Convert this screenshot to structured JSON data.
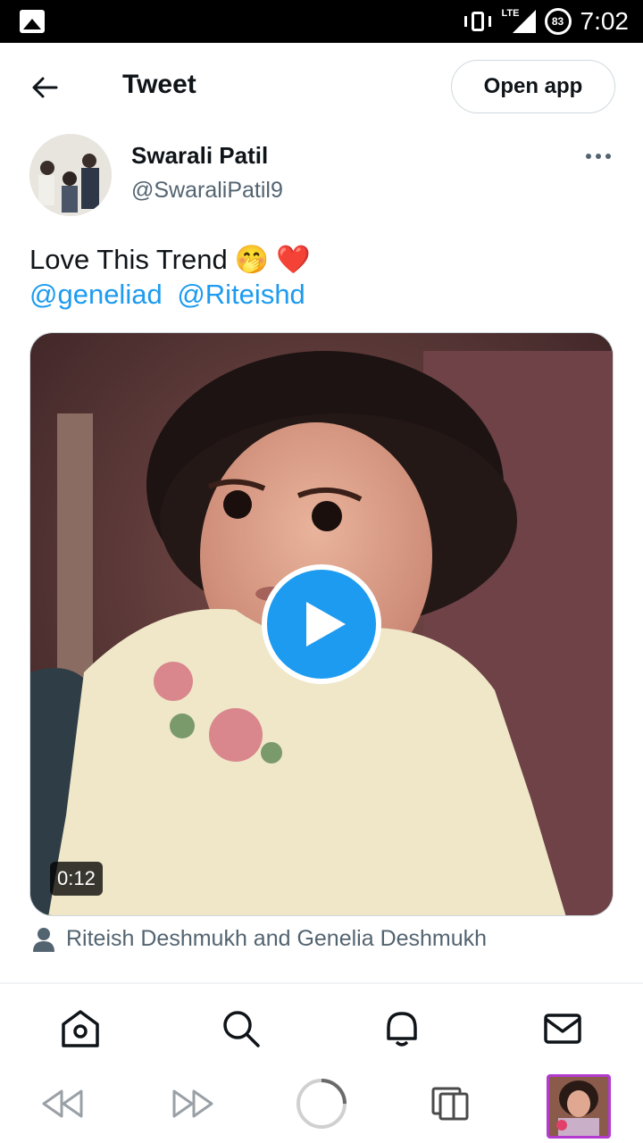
{
  "status_bar": {
    "network": "LTE",
    "battery": "83",
    "time": "7:02",
    "icons": [
      "gallery-icon",
      "vibrate-icon",
      "signal-icon",
      "battery-icon"
    ]
  },
  "header": {
    "title": "Tweet",
    "open_app_label": "Open app"
  },
  "tweet": {
    "author_name": "Swarali Patil",
    "author_handle": "@SwaraliPatil9",
    "text": "Love This Trend",
    "emojis": [
      "🤭",
      "❤️"
    ],
    "mentions": [
      "@geneliad",
      "@Riteishd"
    ],
    "video_duration": "0:12",
    "tagged_users": "Riteish Deshmukh and Genelia Deshmukh"
  },
  "bottom_nav": {
    "items": [
      "home-icon",
      "search-icon",
      "notifications-icon",
      "messages-icon"
    ]
  },
  "browser_bar": {
    "items": [
      "rewind-icon",
      "fast-forward-icon",
      "loading-icon",
      "tabs-icon",
      "app-thumbnail"
    ]
  },
  "colors": {
    "accent": "#1d9bf0",
    "text": "#0f1419",
    "secondary": "#536471",
    "border": "#cfd9de",
    "thumb_border": "#b33ccf"
  }
}
